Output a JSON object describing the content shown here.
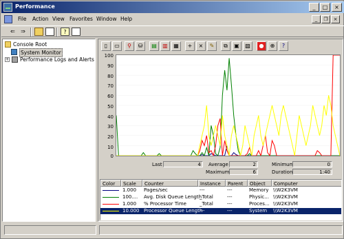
{
  "window": {
    "title": "Performance"
  },
  "menubar": {
    "items": [
      {
        "label": "File"
      },
      {
        "label": "Action"
      },
      {
        "label": "View"
      },
      {
        "label": "Favorites"
      },
      {
        "label": "Window"
      },
      {
        "label": "Help"
      }
    ]
  },
  "tree": {
    "root": "Console Root",
    "items": [
      {
        "label": "System Monitor",
        "selected": true
      },
      {
        "label": "Performance Logs and Alerts"
      }
    ]
  },
  "graph": {
    "y_ticks": [
      "100",
      "90",
      "80",
      "70",
      "60",
      "50",
      "40",
      "30",
      "20",
      "10",
      "0"
    ]
  },
  "stats": {
    "last_label": "Last",
    "last_value": "4",
    "average_label": "Average",
    "average_value": "2",
    "minimum_label": "Minimum",
    "minimum_value": "0",
    "maximum_label": "Maximum",
    "maximum_value": "6",
    "duration_label": "Duration",
    "duration_value": "1:40"
  },
  "legend": {
    "headers": [
      "Color",
      "Scale",
      "Counter",
      "Instance",
      "Parent",
      "Object",
      "Computer"
    ],
    "rows": [
      {
        "color": "#000080",
        "scale": "1.000",
        "counter": "Pages/sec",
        "instance": "---",
        "parent": "---",
        "object": "Memory",
        "computer": "\\\\W2K3VM"
      },
      {
        "color": "#008000",
        "scale": "100....",
        "counter": "Avg. Disk Queue Length",
        "instance": "_Total",
        "parent": "---",
        "object": "Physic...",
        "computer": "\\\\W2K3VM"
      },
      {
        "color": "#ff0000",
        "scale": "1.000",
        "counter": "% Processor Time",
        "instance": "_Total",
        "parent": "---",
        "object": "Proces...",
        "computer": "\\\\W2K3VM"
      },
      {
        "color": "#ffff00",
        "scale": "10.000",
        "counter": "Processor Queue Length",
        "instance": "---",
        "parent": "---",
        "object": "System",
        "computer": "\\\\W2K3VM",
        "selected": true
      }
    ]
  },
  "chart_data": {
    "type": "line",
    "ylim": [
      0,
      100
    ],
    "series": [
      {
        "name": "Pages/sec",
        "color": "#000080",
        "values": [
          0,
          0,
          0,
          0,
          0,
          0,
          0,
          0,
          0,
          0,
          0,
          0,
          0,
          0,
          0,
          0,
          0,
          0,
          0,
          0,
          0,
          0,
          0,
          0,
          0,
          0,
          0,
          0,
          0,
          0,
          0,
          0,
          0,
          0,
          0,
          0,
          0,
          0,
          1,
          0,
          0,
          0,
          2,
          1,
          0,
          0,
          0,
          0,
          0,
          10,
          0,
          0,
          3,
          1,
          0,
          0,
          0,
          0,
          0,
          0,
          0,
          0,
          0,
          0,
          0,
          0,
          0,
          0,
          0,
          0,
          0,
          0,
          0,
          0,
          0,
          0,
          0,
          0,
          0,
          0,
          0,
          0,
          0,
          0,
          0,
          0,
          0,
          0,
          0,
          0,
          0,
          0,
          0,
          0,
          0,
          0,
          0,
          0,
          0,
          0
        ]
      },
      {
        "name": "Avg. Disk Queue Length",
        "color": "#008000",
        "values": [
          40,
          0,
          0,
          0,
          0,
          0,
          0,
          0,
          0,
          0,
          0,
          0,
          3,
          0,
          0,
          0,
          0,
          0,
          0,
          2,
          0,
          0,
          0,
          0,
          0,
          0,
          0,
          0,
          0,
          0,
          0,
          0,
          0,
          0,
          5,
          2,
          0,
          0,
          3,
          0,
          8,
          0,
          30,
          20,
          2,
          0,
          8,
          60,
          85,
          65,
          97,
          70,
          40,
          20,
          5,
          0,
          0,
          0,
          0,
          2,
          0,
          0,
          0,
          0,
          0,
          0,
          0,
          0,
          0,
          0,
          0,
          0,
          0,
          0,
          0,
          0,
          0,
          0,
          0,
          0,
          0,
          0,
          0,
          0,
          0,
          0,
          0,
          0,
          0,
          0,
          0,
          0,
          0,
          0,
          0,
          0,
          0,
          0,
          0,
          0
        ]
      },
      {
        "name": "% Processor Time",
        "color": "#ff0000",
        "values": [
          0,
          0,
          0,
          0,
          0,
          0,
          0,
          0,
          0,
          0,
          0,
          0,
          0,
          0,
          0,
          0,
          0,
          0,
          0,
          0,
          0,
          0,
          0,
          0,
          0,
          0,
          0,
          0,
          0,
          0,
          0,
          0,
          0,
          0,
          0,
          0,
          0,
          5,
          15,
          10,
          20,
          3,
          5,
          0,
          10,
          30,
          37,
          0,
          15,
          5,
          0,
          0,
          0,
          0,
          0,
          0,
          0,
          0,
          2,
          8,
          0,
          0,
          0,
          5,
          0,
          10,
          20,
          3,
          0,
          15,
          10,
          0,
          0,
          0,
          0,
          0,
          0,
          0,
          0,
          0,
          0,
          0,
          0,
          0,
          0,
          0,
          0,
          0,
          0,
          5,
          3,
          0,
          0,
          0,
          0,
          0,
          100,
          100,
          100,
          100
        ]
      },
      {
        "name": "Processor Queue Length",
        "color": "#ffff00",
        "values": [
          0,
          0,
          0,
          0,
          0,
          0,
          0,
          0,
          0,
          0,
          0,
          0,
          0,
          0,
          0,
          0,
          0,
          0,
          0,
          0,
          0,
          0,
          0,
          0,
          0,
          0,
          0,
          0,
          0,
          0,
          0,
          0,
          0,
          0,
          0,
          0,
          0,
          10,
          20,
          30,
          50,
          20,
          10,
          20,
          30,
          20,
          10,
          40,
          20,
          10,
          0,
          20,
          30,
          20,
          10,
          0,
          10,
          30,
          20,
          10,
          0,
          20,
          30,
          40,
          20,
          10,
          20,
          30,
          40,
          50,
          40,
          30,
          20,
          40,
          50,
          40,
          30,
          20,
          10,
          0,
          20,
          40,
          30,
          20,
          10,
          20,
          30,
          50,
          40,
          30,
          20,
          30,
          50,
          40,
          60,
          50,
          30,
          20,
          10,
          0
        ]
      }
    ]
  }
}
